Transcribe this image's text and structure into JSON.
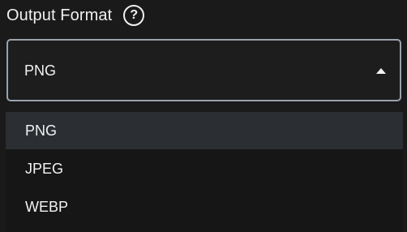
{
  "field": {
    "label": "Output Format",
    "help_icon": "question-circle-icon",
    "help_glyph": "?"
  },
  "select": {
    "value": "PNG",
    "expanded": true,
    "caret_icon": "caret-up-icon"
  },
  "options": [
    {
      "label": "PNG",
      "selected": true
    },
    {
      "label": "JPEG",
      "selected": false
    },
    {
      "label": "WEBP",
      "selected": false
    }
  ],
  "colors": {
    "background": "#1a1a1a",
    "border": "#9aa3ad",
    "selected_option": "#2b2f33",
    "text": "#f2f2f2"
  }
}
